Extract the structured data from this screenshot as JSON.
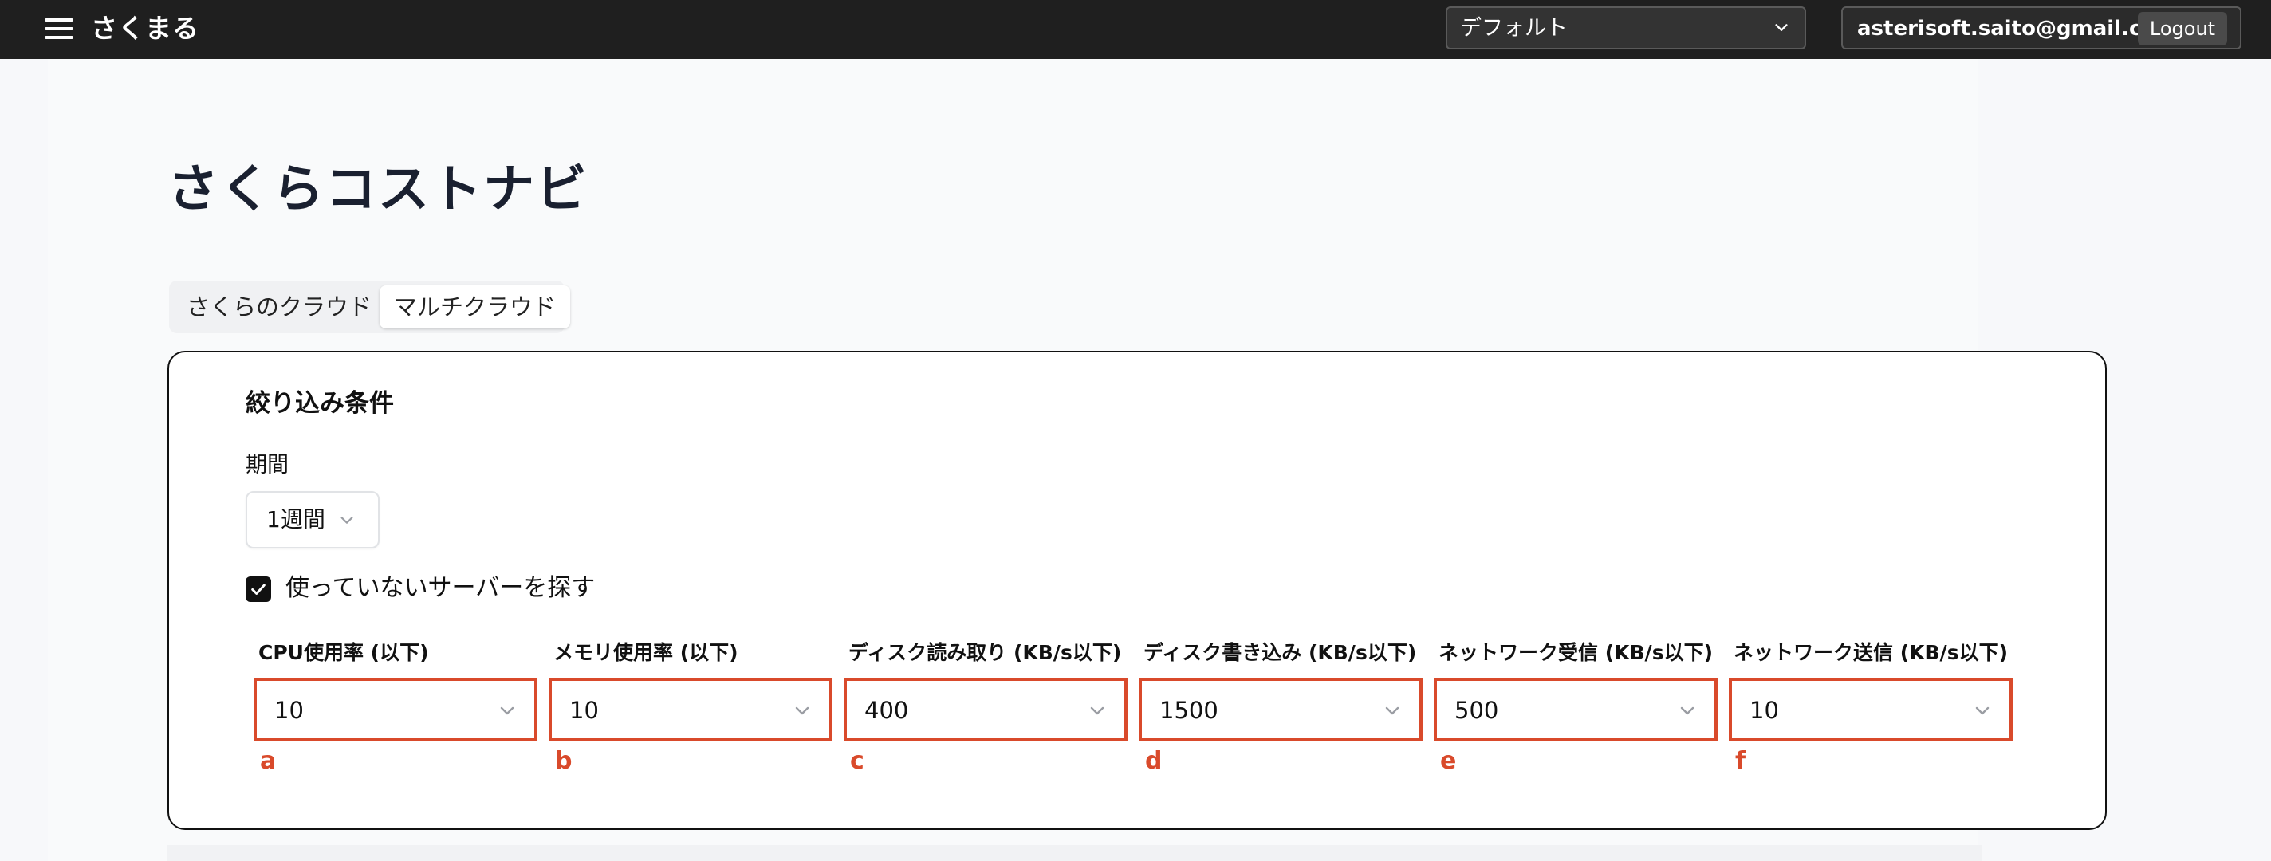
{
  "topbar": {
    "app_title": "さくまる",
    "project_select": {
      "value": "デフォルト"
    },
    "user_email": "asterisoft.saito@gmail.com",
    "logout_label": "Logout"
  },
  "page": {
    "title": "さくらコストナビ",
    "tabs": [
      {
        "label": "さくらのクラウド",
        "active": false
      },
      {
        "label": "マルチクラウド",
        "active": true
      }
    ]
  },
  "filter": {
    "title": "絞り込み条件",
    "period_label": "期間",
    "period_value": "1週間",
    "unused_checkbox": {
      "label": "使っていないサーバーを探す",
      "checked": true
    },
    "thresholds": [
      {
        "label": "CPU使用率 (以下)",
        "value": "10",
        "marker": "a"
      },
      {
        "label": "メモリ使用率 (以下)",
        "value": "10",
        "marker": "b"
      },
      {
        "label": "ディスク読み取り (KB/s以下)",
        "value": "400",
        "marker": "c"
      },
      {
        "label": "ディスク書き込み (KB/s以下)",
        "value": "1500",
        "marker": "d"
      },
      {
        "label": "ネットワーク受信 (KB/s以下)",
        "value": "500",
        "marker": "e"
      },
      {
        "label": "ネットワーク送信 (KB/s以下)",
        "value": "10",
        "marker": "f"
      }
    ]
  },
  "colors": {
    "topbar_bg": "#1f1f1f",
    "highlight_red": "#d94a2b",
    "title_text": "#1a2030"
  },
  "icons": {
    "menu": "hamburger-menu-icon",
    "dropdown": "chevron-down-icon",
    "checkbox": "checkmark-icon"
  }
}
